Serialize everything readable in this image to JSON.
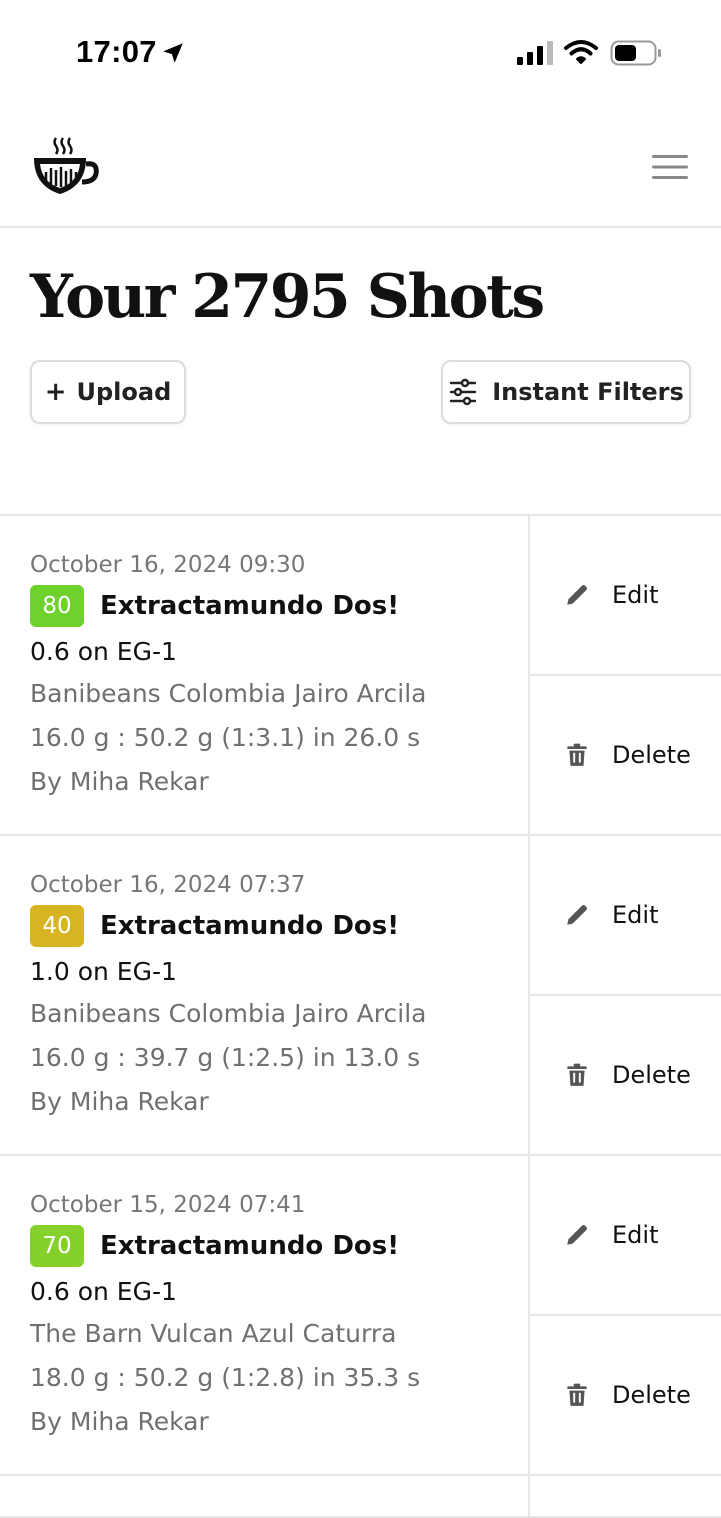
{
  "status_bar": {
    "time": "17:07"
  },
  "header": {
    "logo_icon": "coffee-cup-logo",
    "menu_icon": "hamburger-menu-icon"
  },
  "page": {
    "title": "Your 2795 Shots",
    "upload_plus": "+",
    "upload_label": "Upload",
    "filters_label": "Instant Filters"
  },
  "colors": {
    "score_high": "#6fcf2b",
    "score_mid": "#d4b21f",
    "border": "#e6e6e6"
  },
  "shots": [
    {
      "date": "October 16, 2024 09:30",
      "score": "80",
      "score_color": "#6fd12c",
      "name": "Extractamundo Dos!",
      "grind": "0.6 on EG-1",
      "bean": "Banibeans Colombia Jairo Arcila",
      "ratio": "16.0 g : 50.2 g (1:3.1) in 26.0 s",
      "author": "By Miha Rekar",
      "edit_label": "Edit",
      "delete_label": "Delete"
    },
    {
      "date": "October 16, 2024 07:37",
      "score": "40",
      "score_color": "#d6b422",
      "name": "Extractamundo Dos!",
      "grind": "1.0 on EG-1",
      "bean": "Banibeans Colombia Jairo Arcila",
      "ratio": "16.0 g : 39.7 g (1:2.5) in 13.0 s",
      "author": "By Miha Rekar",
      "edit_label": "Edit",
      "delete_label": "Delete"
    },
    {
      "date": "October 15, 2024 07:41",
      "score": "70",
      "score_color": "#86d02c",
      "name": "Extractamundo Dos!",
      "grind": "0.6 on EG-1",
      "bean": "The Barn Vulcan Azul Caturra",
      "ratio": "18.0 g : 50.2 g (1:2.8) in 35.3 s",
      "author": "By Miha Rekar",
      "edit_label": "Edit",
      "delete_label": "Delete"
    }
  ]
}
